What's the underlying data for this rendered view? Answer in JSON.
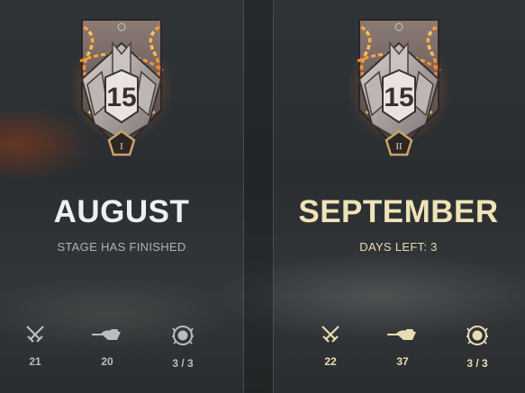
{
  "stages": [
    {
      "month": "AUGUST",
      "status": "STAGE HAS FINISHED",
      "badge": {
        "level": "15",
        "roman": "I"
      },
      "stats": [
        {
          "icon": "crossed-swords-icon",
          "value": "21"
        },
        {
          "icon": "tank-silhouette-icon",
          "value": "20"
        },
        {
          "icon": "wreath-emblem-icon",
          "value": "3 / 3"
        }
      ],
      "accent": "#eef0f0"
    },
    {
      "month": "SEPTEMBER",
      "status": "DAYS LEFT: 3",
      "badge": {
        "level": "15",
        "roman": "II"
      },
      "stats": [
        {
          "icon": "crossed-swords-icon",
          "value": "22"
        },
        {
          "icon": "tank-silhouette-icon",
          "value": "37"
        },
        {
          "icon": "wreath-emblem-icon",
          "value": "3 / 3"
        }
      ],
      "accent": "#efe2b6"
    }
  ]
}
